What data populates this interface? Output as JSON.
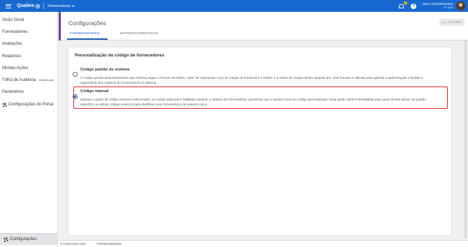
{
  "topbar": {
    "logo": "Qualiex",
    "module": "Fornecedores",
    "user_name": "Joyce (Administrador)",
    "user_org": "FL EAD"
  },
  "sidebar": {
    "items": [
      {
        "label": "Visão Geral"
      },
      {
        "label": "Fornecedores"
      },
      {
        "label": "Avaliações"
      },
      {
        "label": "Relatórios"
      },
      {
        "label": "Minhas Ações"
      },
      {
        "label": "Trilha de Auditoria",
        "sub": "(Simplificada)"
      },
      {
        "label": "Parâmetros"
      },
      {
        "label": "Configurações do Portal"
      }
    ],
    "bottom": "Configurações"
  },
  "header": {
    "title": "Configurações",
    "tabs": [
      "FORNECEDORES",
      "MATERIAIS/SERVIÇOS"
    ],
    "save_label": "SALVAR"
  },
  "card": {
    "title": "Personalização do código de fornecedores",
    "options": [
      {
        "title": "Código padrão do sistema",
        "desc": "O código gerado automaticamente pelo sistema segue o formato 25-00001, onde '25' representa o ano de criação do fornecedor e '00001' é a ordem de criação dentro daquele ano. Este formato é utilizado para garantir a padronização e facilitar a organização dos registros de fornecedores no sistema.",
        "selected": false
      },
      {
        "title": "Código manual",
        "desc": "Quando a opção de código manual é selecionada, um campo adicional é habilitado durante o cadastro de fornecedores, permitindo que o usuário insira um código personalizado. Essa opção oferece flexibilidade para quem deseja adotar um padrão específico ou utilizar códigos externos para identificar seus fornecedores de maneira única.",
        "selected": true
      }
    ]
  },
  "footer": {
    "copyright": "© FORLOGIC 2025",
    "module": "FORNECEDORES"
  },
  "colors": {
    "topbar": "#1769d1",
    "accent": "#6b3fa0",
    "tab_active": "#1e5fb3",
    "highlight": "#e02424"
  }
}
